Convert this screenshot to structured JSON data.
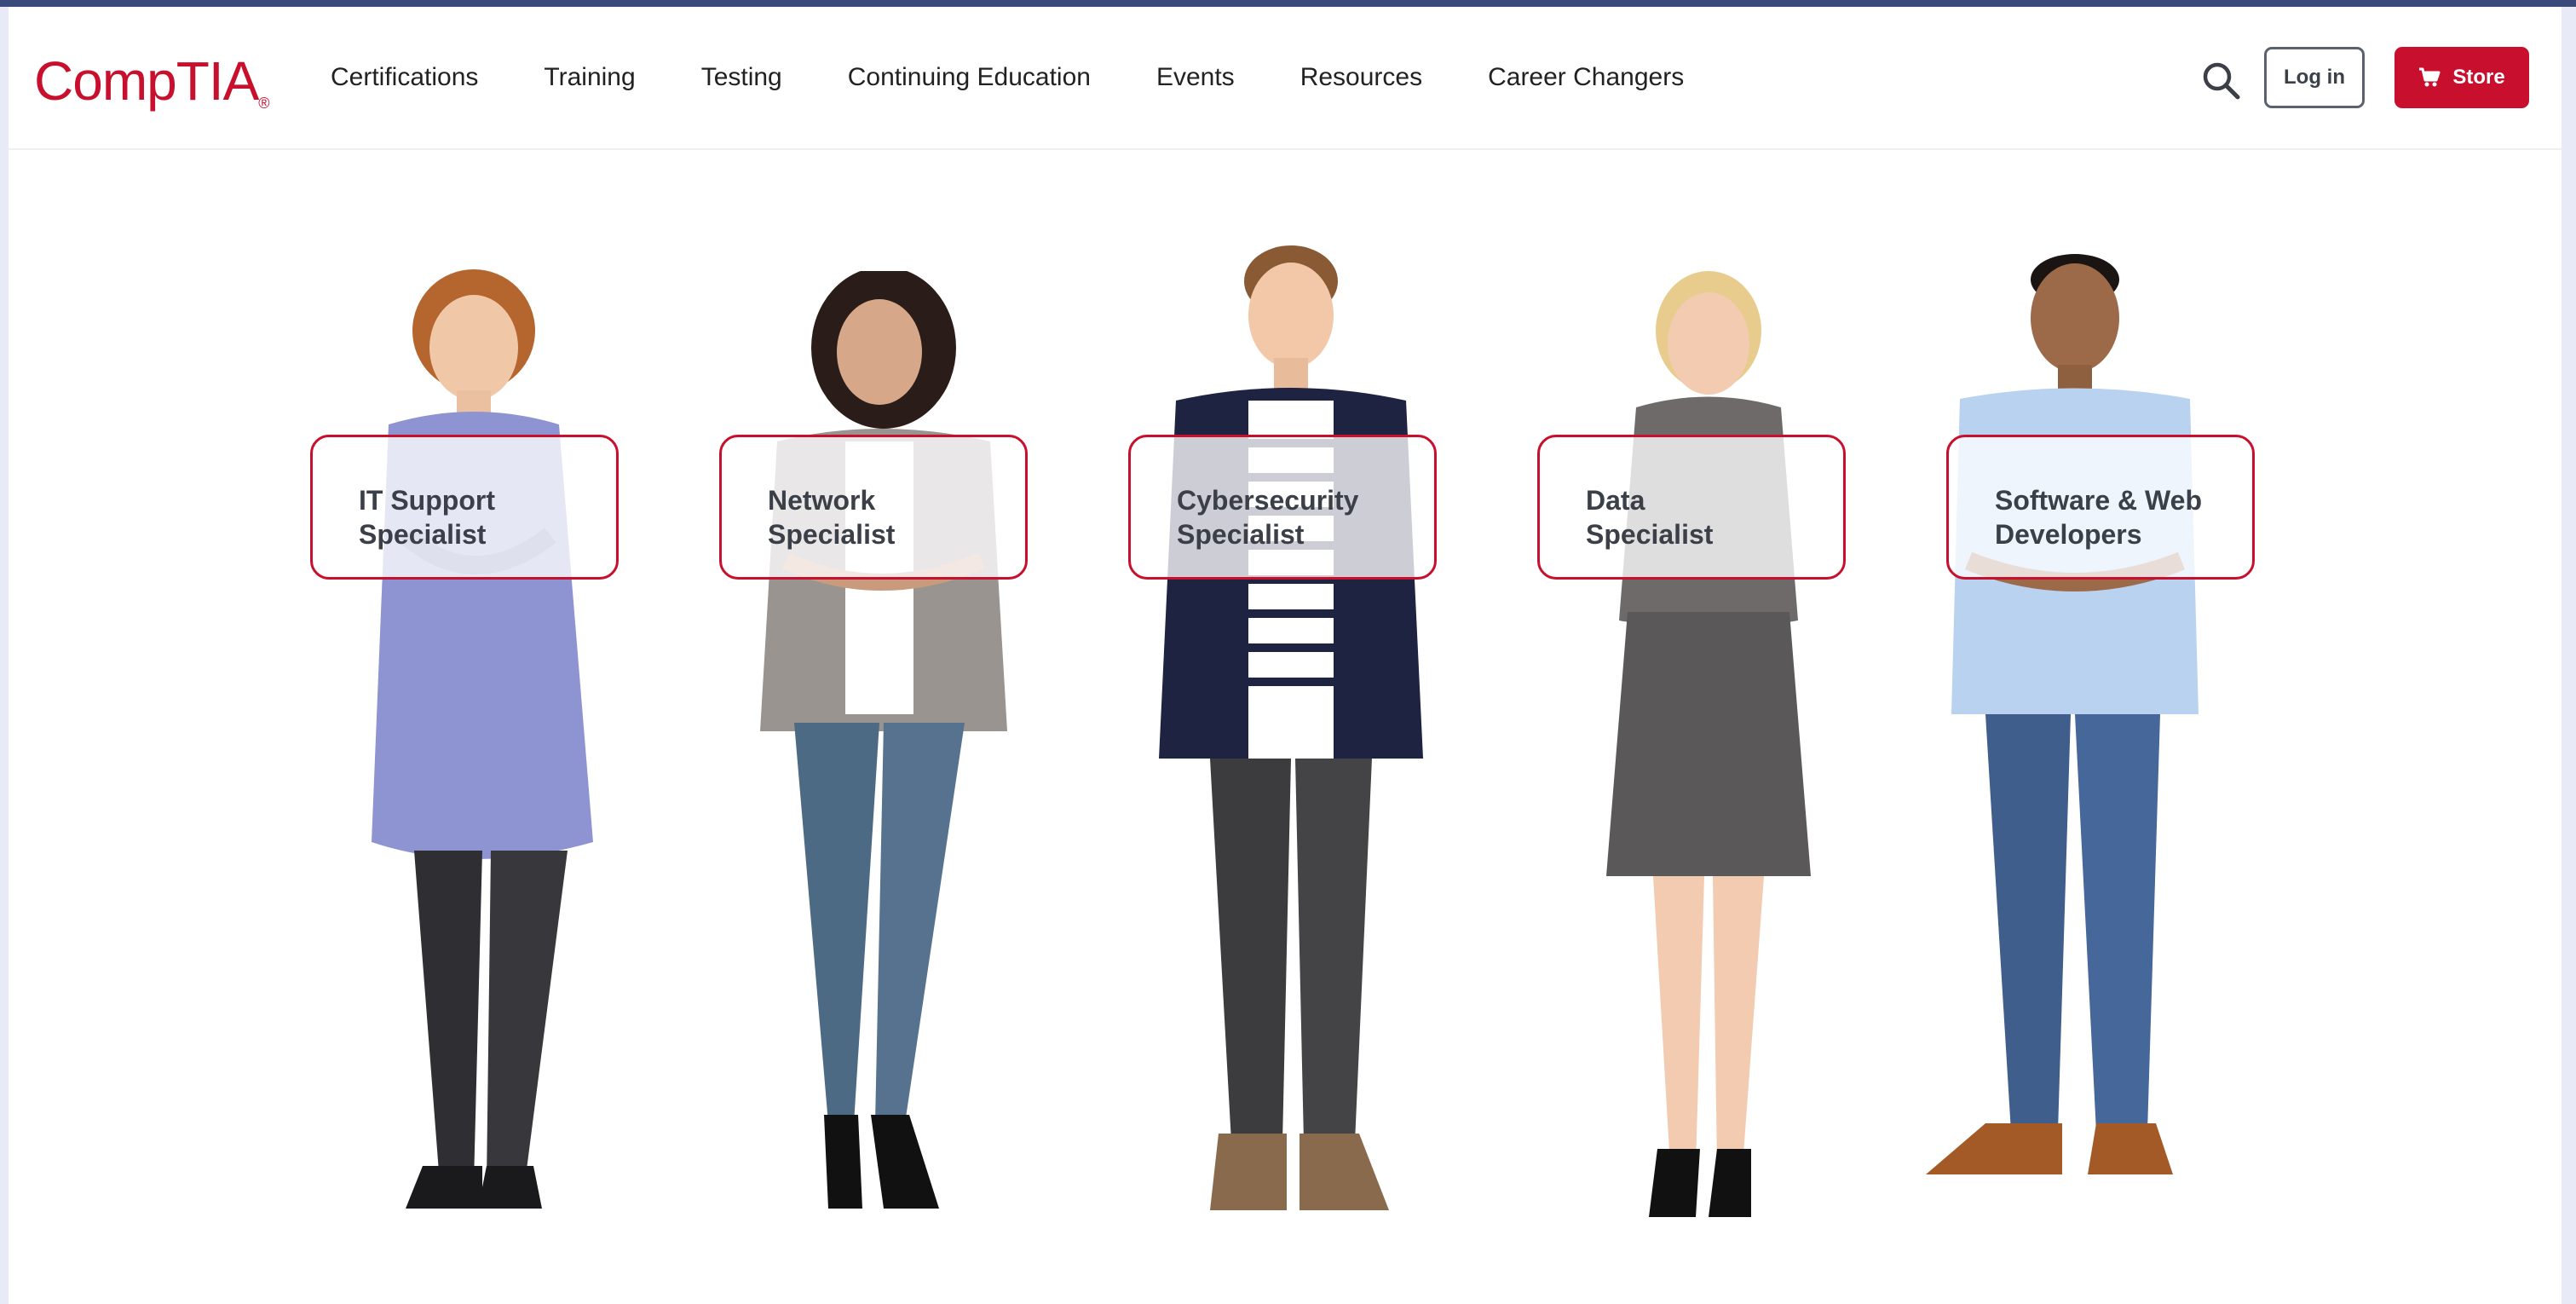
{
  "header": {
    "logo_text": "CompTIA",
    "logo_reg": "®",
    "nav": [
      {
        "label": "Certifications"
      },
      {
        "label": "Training"
      },
      {
        "label": "Testing"
      },
      {
        "label": "Continuing Education"
      },
      {
        "label": "Events"
      },
      {
        "label": "Resources"
      },
      {
        "label": "Career Changers"
      }
    ],
    "search_icon": "search-icon",
    "login_label": "Log in",
    "store_label": "Store",
    "store_icon": "cart-icon"
  },
  "careers": [
    {
      "line1": "IT Support",
      "line2": "Specialist"
    },
    {
      "line1": "Network",
      "line2": "Specialist"
    },
    {
      "line1": "Cybersecurity",
      "line2": "Specialist"
    },
    {
      "line1": "Data",
      "line2": "Specialist"
    },
    {
      "line1": "Software & Web",
      "line2": "Developers"
    }
  ],
  "colors": {
    "brand": "#c8102e",
    "text": "#222222",
    "card_text": "#3a3f48"
  }
}
